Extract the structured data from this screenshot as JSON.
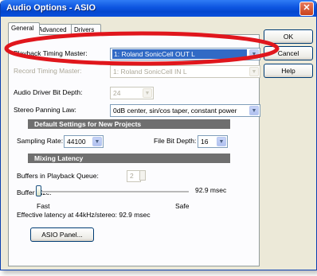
{
  "window": {
    "title": "Audio Options - ASIO",
    "close_glyph": "✕"
  },
  "tabs": [
    {
      "label": "General",
      "active": true
    },
    {
      "label": "Advanced",
      "active": false
    },
    {
      "label": "Drivers",
      "active": false
    }
  ],
  "buttons": {
    "ok": "OK",
    "cancel": "Cancel",
    "help": "Help",
    "asio_panel": "ASIO Panel..."
  },
  "general": {
    "playback_label": "Playback Timing Master:",
    "playback_value": "1: Roland SonicCell OUT L",
    "record_label": "Record Timing Master:",
    "record_value": "1: Roland SonicCell IN L",
    "bit_depth_label": "Audio Driver Bit Depth:",
    "bit_depth_value": "24",
    "panning_label": "Stereo Panning Law:",
    "panning_value": "0dB center, sin/cos taper, constant power"
  },
  "defaults": {
    "heading": "Default Settings for New Projects",
    "sampling_label": "Sampling Rate:",
    "sampling_value": "44100",
    "file_bit_label": "File Bit Depth:",
    "file_bit_value": "16"
  },
  "latency": {
    "heading": "Mixing Latency",
    "buffers_label": "Buffers in Playback Queue:",
    "buffers_value": "2",
    "buffer_size_label": "Buffer Size:",
    "buffer_size_value": "92.9 msec",
    "slider_fraction": 0.0,
    "fast_label": "Fast",
    "safe_label": "Safe",
    "effective_label": "Effective latency at 44kHz/stereo:  92.9 msec"
  },
  "icons": {
    "dropdown": "chevron-down-icon",
    "close": "close-icon"
  },
  "colors": {
    "title_bar": "#0d55e0",
    "selection": "#316ac5",
    "annotation": "#e0161c",
    "section_header": "#6f6f6f"
  }
}
